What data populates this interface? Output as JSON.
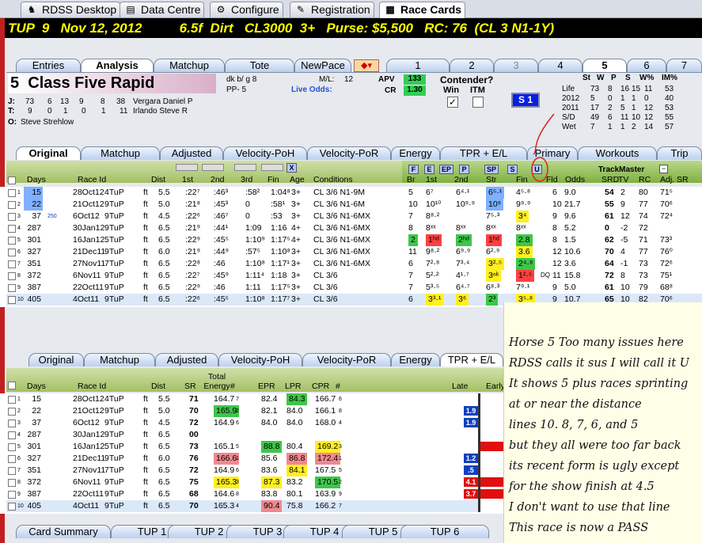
{
  "top_tabs": [
    {
      "label": "RDSS Desktop",
      "icon": "horse-icon"
    },
    {
      "label": "Data Centre",
      "icon": "database-icon"
    },
    {
      "label": "Configure",
      "icon": "gear-icon"
    },
    {
      "label": "Registration",
      "icon": "key-icon"
    },
    {
      "label": "Race Cards",
      "icon": "card-icon"
    }
  ],
  "race_header": "TUP  9   Nov 12, 2012          6.5f  Dirt   CL3000  3+   Purse: $5,500   RC: 76  (CL 3 N1-1Y)",
  "view_tabs": [
    "Entries",
    "Analysis",
    "Matchup",
    "Tote",
    "NewPace"
  ],
  "horse_tabs": [
    "1",
    "2",
    "3",
    "4",
    "5",
    "6",
    "7"
  ],
  "horse": {
    "number": "5",
    "name": "Class Five Rapid",
    "desc": "dk b/ g 8",
    "pp": "PP- 5",
    "ml_label": "M/L:",
    "ml": "12",
    "live_odds": "Live Odds:",
    "apv_label": "APV",
    "apv": "133",
    "cr_label": "CR",
    "cr": "1.30",
    "jockey_label": "J:",
    "jockey_stats": [
      "73",
      "6",
      "13",
      "9",
      "8",
      "38"
    ],
    "jockey": "Vergara Daniel P",
    "trainer_label": "T:",
    "trainer_stats": [
      "9",
      "0",
      "1",
      "0",
      "1",
      "11"
    ],
    "trainer": "Irlando Steve R",
    "owner_label": "O:",
    "owner": "Steve Strehlow",
    "contender": "Contender?",
    "win": "Win",
    "itm": "ITM",
    "s1": "S 1"
  },
  "stats": {
    "headers": [
      "St",
      "W",
      "P",
      "S",
      "W%",
      "IM%"
    ],
    "rows": [
      [
        "Life",
        "73",
        "8",
        "16",
        "15",
        "11",
        "53"
      ],
      [
        "2012",
        "5",
        "0",
        "1",
        "1",
        "0",
        "40"
      ],
      [
        "2011",
        "17",
        "2",
        "5",
        "1",
        "12",
        "53"
      ],
      [
        "S/D",
        "49",
        "6",
        "11",
        "10",
        "12",
        "55"
      ],
      [
        "Wet",
        "7",
        "1",
        "1",
        "2",
        "14",
        "57"
      ]
    ]
  },
  "grid1_tabs": [
    "Original",
    "Matchup",
    "Adjusted",
    "Velocity-PoH",
    "Velocity-PoR",
    "Energy",
    "TPR + E/L",
    "Primary",
    "Workouts",
    "Trip"
  ],
  "grid1_headers": {
    "days": "Days",
    "race": "Race Id",
    "dist": "Dist",
    "c1": "1st",
    "c2": "2nd",
    "c3": "3rd",
    "fin": "Fin",
    "age": "Age",
    "cond": "Conditions",
    "br": "Br",
    "s1": "1st",
    "s2": "2nd",
    "str": "Str",
    "sfin": "Fin",
    "fld": "Fld",
    "odds": "Odds",
    "tm": "TrackMaster",
    "srd": "SRD",
    "tv": "TV",
    "rc": "RC",
    "adj": "Adj. SR",
    "x": "X"
  },
  "style_buttons": [
    "F",
    "E",
    "EP",
    "P",
    "SP",
    "S",
    "U"
  ],
  "grid1_rows": [
    [
      "1",
      "15",
      "28Oct12",
      "4TuP",
      "ft",
      "5.5",
      ":22⁷",
      ":46³",
      ":58²",
      "1:04⁸",
      "3+",
      "CL 3/6 N1-9M",
      "5",
      "6⁷",
      "6⁴·¹",
      "6⁵·¹",
      "4⁵·⁸",
      "6",
      "9.0",
      "54",
      "2",
      "80",
      "71⁵"
    ],
    [
      "2",
      "22",
      "21Oct12",
      "9TuP",
      "ft",
      "5.0",
      ":21⁸",
      ":45³",
      "0",
      ":58¹",
      "3+",
      "CL 3/6 N1-6M",
      "10",
      "10¹⁰",
      "10⁹·⁹",
      "10⁹",
      "9⁹·⁹",
      "10",
      "21.7",
      "55",
      "9",
      "77",
      "70⁶"
    ],
    [
      "3",
      "37",
      "6Oct12",
      "9TuP",
      "ft",
      "4.5",
      ":22⁶",
      ":46⁷",
      "0",
      ":53",
      "3+",
      "CL 3/6 N1-6MX",
      "7",
      "8⁸·²",
      "",
      "7⁵·³",
      "3⁴",
      "9",
      "9.6",
      "61",
      "12",
      "74",
      "72⁴"
    ],
    [
      "4",
      "287",
      "30Jan12",
      "9TuP",
      "ft",
      "6.5",
      ":21⁹",
      ":44¹",
      "1:09",
      "1:16",
      "4+",
      "CL 3/6 N1-6MX",
      "8",
      "8ˣˣ",
      "8ˣˣ",
      "8ˣˣ",
      "8ˣˣ",
      "8",
      "5.2",
      "0",
      "-2",
      "72",
      ""
    ],
    [
      "5",
      "301",
      "16Jan12",
      "5TuP",
      "ft",
      "6.5",
      ":22⁹",
      ":45⁵",
      "1:10⁹",
      "1:17⁵",
      "4+",
      "CL 3/6 N1-6MX",
      "2",
      "1ʰᵈ",
      "2ʰᵈ",
      "1ʰᵈ",
      "2.8",
      "8",
      "1.5",
      "62",
      "-5",
      "71",
      "73³"
    ],
    [
      "6",
      "327",
      "21Dec11",
      "9TuP",
      "ft",
      "6.0",
      ":21⁹",
      ":44⁹",
      ":57⁵",
      "1:10⁸",
      "3+",
      "CL 3/6 N1-6MX",
      "11",
      "9⁸·²",
      "6⁹·⁹",
      "6²·⁹",
      "3.6",
      "12",
      "10.6",
      "70",
      "4",
      "77",
      "76⁰"
    ],
    [
      "7",
      "351",
      "27Nov11",
      "7TuP",
      "ft",
      "6.5",
      ":22⁸",
      ":46",
      "1:10⁸",
      "1:17¹",
      "3+",
      "CL 3/6 N1-6MX",
      "6",
      "7²·⁸",
      "7³·⁴",
      "3²·⁵",
      "2⁴·⁸",
      "12",
      "3.6",
      "64",
      "-1",
      "73",
      "72⁶"
    ],
    [
      "8",
      "372",
      "6Nov11",
      "9TuP",
      "ft",
      "6.5",
      ":22⁷",
      ":45⁹",
      "1:11⁴",
      "1:18",
      "3+",
      "CL 3/6",
      "7",
      "5²·²",
      "4¹·⁷",
      "3ⁿᵏ",
      "1²·⁵",
      "11",
      "15.8",
      "72",
      "8",
      "73",
      "75¹"
    ],
    [
      "9",
      "387",
      "22Oct11",
      "9TuP",
      "ft",
      "6.5",
      ":22⁹",
      ":46",
      "1:11",
      "1:17⁵",
      "3+",
      "CL 3/6",
      "7",
      "5³·⁵",
      "6⁴·⁷",
      "6⁸·³",
      "7⁹·¹",
      "9",
      "5.0",
      "61",
      "10",
      "79",
      "68⁸"
    ],
    [
      "10",
      "405",
      "4Oct11",
      "9TuP",
      "ft",
      "6.5",
      ":22⁶",
      ":45⁵",
      "1:10⁸",
      "1:17⁷",
      "3+",
      "CL 3/6",
      "6",
      "3³·¹",
      "3⁶",
      "2³",
      "3⁵·⁸",
      "9",
      "10.7",
      "65",
      "10",
      "82",
      "70⁶"
    ]
  ],
  "dq_label": "DQ",
  "grid2_tabs": [
    "Original",
    "Matchup",
    "Adjusted",
    "Velocity-PoH",
    "Velocity-PoR",
    "Energy",
    "TPR + E/L"
  ],
  "grid2_headers": {
    "days": "Days",
    "race": "Race Id",
    "dist": "Dist",
    "sr": "SR",
    "te": "Total Energy",
    "hash": "#",
    "epr": "EPR",
    "lpr": "LPR",
    "cpr": "CPR",
    "late": "Late",
    "early": "Early"
  },
  "grid2_rows": [
    [
      "1",
      "15",
      "28Oct12",
      "4TuP",
      "ft",
      "5.5",
      "71",
      "164.7",
      "7",
      "82.4",
      "84.3",
      "166.7",
      "6"
    ],
    [
      "2",
      "22",
      "21Oct12",
      "9TuP",
      "ft",
      "5.0",
      "70",
      "165.9",
      "2",
      "82.1",
      "84.0",
      "166.1",
      "8"
    ],
    [
      "3",
      "37",
      "6Oct12",
      "9TuP",
      "ft",
      "4.5",
      "72",
      "164.9",
      "6",
      "84.0",
      "84.0",
      "168.0",
      "4"
    ],
    [
      "4",
      "287",
      "30Jan12",
      "9TuP",
      "ft",
      "6.5",
      "00",
      "",
      "",
      "",
      "",
      "",
      ""
    ],
    [
      "5",
      "301",
      "16Jan12",
      "5TuP",
      "ft",
      "6.5",
      "73",
      "165.1",
      "5",
      "88.8",
      "80.4",
      "169.2",
      "3"
    ],
    [
      "6",
      "327",
      "21Dec11",
      "9TuP",
      "ft",
      "6.0",
      "76",
      "166.6",
      "1",
      "85.6",
      "86.8",
      "172.4",
      "1"
    ],
    [
      "7",
      "351",
      "27Nov11",
      "7TuP",
      "ft",
      "6.5",
      "72",
      "164.9",
      "6",
      "83.6",
      "84.1",
      "167.5",
      "5"
    ],
    [
      "8",
      "372",
      "6Nov11",
      "9TuP",
      "ft",
      "6.5",
      "75",
      "165.3",
      "3",
      "87.3",
      "83.2",
      "170.5",
      "2"
    ],
    [
      "9",
      "387",
      "22Oct11",
      "9TuP",
      "ft",
      "6.5",
      "68",
      "164.6",
      "8",
      "83.8",
      "80.1",
      "163.9",
      "9"
    ],
    [
      "10",
      "405",
      "4Oct11",
      "9TuP",
      "ft",
      "6.5",
      "70",
      "165.3",
      "4",
      "90.4",
      "75.8",
      "166.2",
      "7"
    ]
  ],
  "late_values": {
    "r2": "1.9",
    "r3": "1.9",
    "r6": "1.2",
    "r7": ".5",
    "r8": "4.1",
    "r9": "3.7"
  },
  "bottom_tabs": [
    "Card Summary",
    "TUP 1",
    "TUP 2",
    "TUP 3",
    "TUP 4",
    "TUP 5",
    "TUP 6"
  ],
  "note_lines": [
    "Horse 5 Too many issues here",
    "RDSS calls it sus I will call it U",
    "It shows 5 plus races sprinting",
    "at or near the distance",
    "lines 10. 8, 7, 6, and 5",
    "but they all were too far back",
    "its recent form is ugly except",
    "for the show finish at 4.5",
    "I don't want to use that line",
    "This race is now a PASS"
  ],
  "colors": {
    "header_yellow": "#ffff00",
    "note_bg": "#ffffe8",
    "apv_green": "#33cc55"
  }
}
